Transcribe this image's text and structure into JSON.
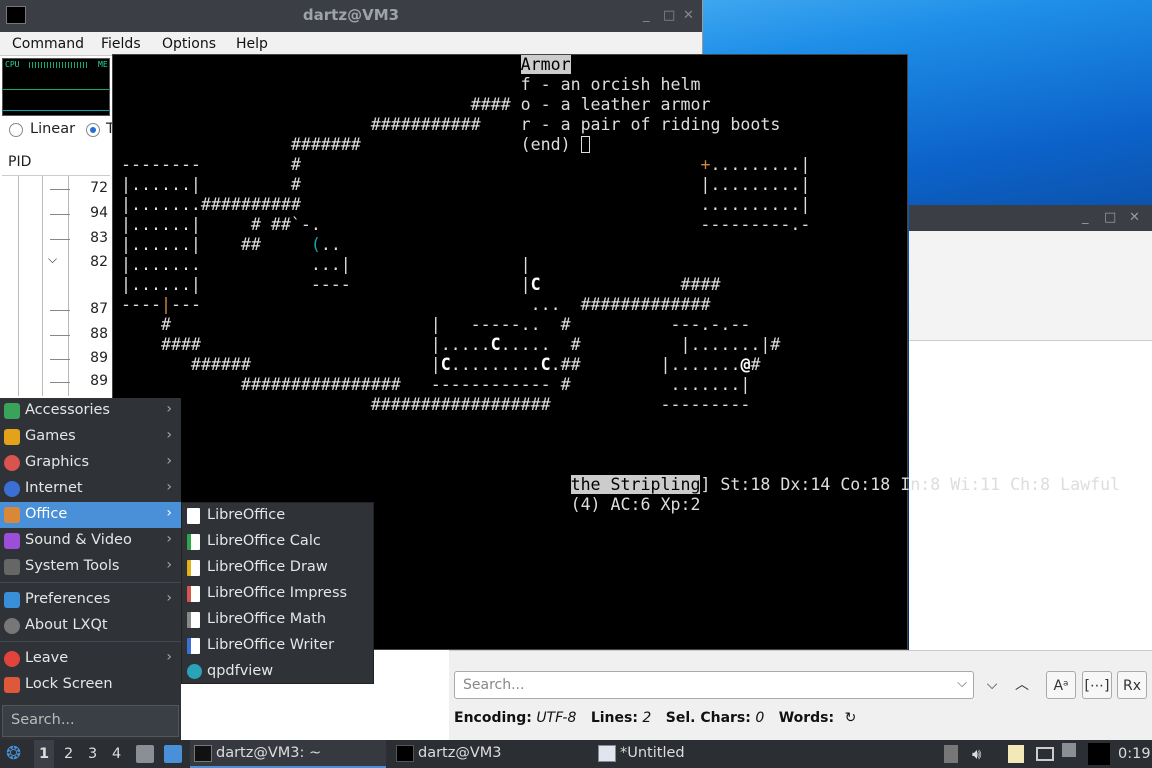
{
  "back_window": {
    "title": "dartz@VM3",
    "controls": [
      "_",
      "□",
      "✕"
    ],
    "menu": [
      "Command",
      "Fields",
      "Options",
      "Help"
    ],
    "graph_labels": [
      "CPU",
      "ME"
    ],
    "radio_linear": "Linear",
    "radio_other": "T",
    "pid_header": "PID",
    "pids": [
      "72",
      "94",
      "83",
      "82",
      "87",
      "88",
      "89",
      "89"
    ]
  },
  "terminal": {
    "inventory_title": "Armor",
    "inventory_items": [
      "f - an orcish helm",
      "o - a leather armor",
      "r - a pair of riding boots"
    ],
    "inventory_end": "(end)",
    "status_line_1_name": "the Stripling",
    "status_line_1_stats": "] St:18 Dx:14 Co:18 In:8 Wi:11 Ch:8 Lawful",
    "status_line_2": "(4) AC:6 Xp:2"
  },
  "app_menu": {
    "items": [
      {
        "label": "Accessories",
        "icon": "accessories-icon",
        "color": "#3aa35a"
      },
      {
        "label": "Games",
        "icon": "games-icon",
        "color": "#e3a21a"
      },
      {
        "label": "Graphics",
        "icon": "graphics-icon",
        "color": "#d9534f"
      },
      {
        "label": "Internet",
        "icon": "internet-icon",
        "color": "#3b6fd6"
      },
      {
        "label": "Office",
        "icon": "office-icon",
        "color": "#d9883a"
      },
      {
        "label": "Sound & Video",
        "icon": "sound-video-icon",
        "color": "#9b4fd9"
      },
      {
        "label": "System Tools",
        "icon": "system-tools-icon",
        "color": "#666666"
      },
      {
        "label": "Preferences",
        "icon": "preferences-icon",
        "color": "#3a8fd9"
      },
      {
        "label": "About LXQt",
        "icon": "info-icon",
        "color": "#777777"
      },
      {
        "label": "Leave",
        "icon": "power-icon",
        "color": "#e0443a"
      },
      {
        "label": "Lock Screen",
        "icon": "lock-icon",
        "color": "#e0583a"
      }
    ],
    "search_placeholder": "Search..."
  },
  "office_submenu": {
    "items": [
      {
        "label": "LibreOffice",
        "icon": "libreoffice-icon"
      },
      {
        "label": "LibreOffice Calc",
        "icon": "calc-icon"
      },
      {
        "label": "LibreOffice Draw",
        "icon": "draw-icon"
      },
      {
        "label": "LibreOffice Impress",
        "icon": "impress-icon"
      },
      {
        "label": "LibreOffice Math",
        "icon": "math-icon"
      },
      {
        "label": "LibreOffice Writer",
        "icon": "writer-icon"
      },
      {
        "label": "qpdfview",
        "icon": "qpdfview-icon"
      }
    ]
  },
  "editor": {
    "search_placeholder": "Search...",
    "buttons": {
      "case": "Aᵃ",
      "whole": "[⋯]",
      "regex": "Rx"
    },
    "status": {
      "encoding_label": "Encoding:",
      "encoding": "UTF-8",
      "lines_label": "Lines:",
      "lines": "2",
      "sel_label": "Sel. Chars:",
      "sel": "0",
      "words_label": "Words:"
    }
  },
  "taskbar": {
    "desktops": [
      "1",
      "2",
      "3",
      "4"
    ],
    "tasks": [
      {
        "label": "dartz@VM3: ~",
        "active": true
      },
      {
        "label": "dartz@VM3",
        "active": false
      },
      {
        "label": "*Untitled",
        "active": false
      }
    ],
    "clock": "0:19"
  }
}
